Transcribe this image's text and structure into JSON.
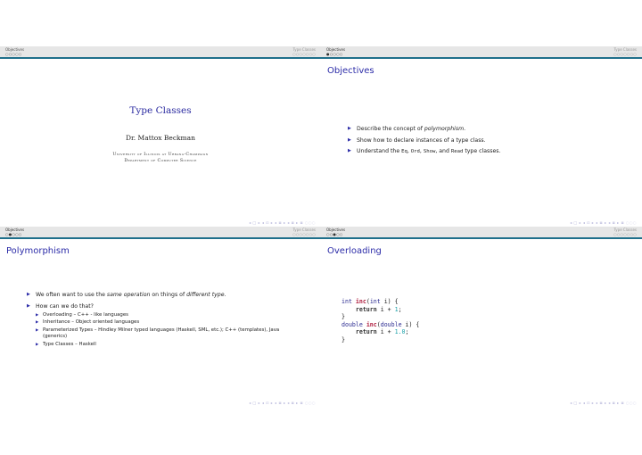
{
  "header": {
    "section_left": "Objectives",
    "section_right": "Type Classes",
    "dots_left_total": 5,
    "dots_right_total": 7
  },
  "slides": [
    {
      "kind": "title",
      "active_section": "none",
      "active_dot": 0,
      "title": "Type Classes",
      "author": "Dr. Mattox Beckman",
      "institution_line1": "University of Illinois at Urbana-Champaign",
      "institution_line2": "Department of Computer Science"
    },
    {
      "kind": "bullets",
      "active_section": "Objectives",
      "active_dot": 1,
      "frametitle": "Objectives",
      "items": [
        {
          "pre": "Describe the concept of ",
          "em": "polymorphism",
          "post": "."
        },
        {
          "text": "Show how to declare instances of a type class."
        },
        {
          "pre": "Understand the ",
          "code1": "Eq",
          "sep1": ", ",
          "code2": "Ord",
          "sep2": ", ",
          "code3": "Show",
          "sep3": ", and ",
          "code4": "Read",
          "post": " type classes."
        }
      ]
    },
    {
      "kind": "bullets",
      "active_section": "Objectives",
      "active_dot": 2,
      "frametitle": "Polymorphism",
      "items": [
        {
          "pre": "We often want to use the ",
          "em1": "same operation",
          "mid": " on things of ",
          "em2": "different type",
          "post": "."
        },
        {
          "text": "How can we do that?",
          "sub": [
            "Overloading – C++ - like languages",
            "Inheritance – Object oriented languages",
            "Parameterized Types – Hindley Milner typed languages (Haskell, SML, etc.); C++ (templates), Java (generics)",
            "Type Classes – Haskell"
          ]
        }
      ]
    },
    {
      "kind": "code",
      "active_section": "Objectives",
      "active_dot": 3,
      "frametitle": "Overloading",
      "code": {
        "l1_type": "int",
        "l1_fn": "inc",
        "l1_open": "(",
        "l1_ptype": "int",
        "l1_rest": " i) {",
        "l2_kw": "return",
        "l2_expr": " i + ",
        "l2_num": "1",
        "l2_end": ";",
        "l3": "}",
        "l4_type": "double",
        "l4_fn": "inc",
        "l4_open": "(",
        "l4_ptype": "double",
        "l4_rest": " i) {",
        "l5_kw": "return",
        "l5_expr": " i + ",
        "l5_num": "1.0",
        "l5_end": ";",
        "l6": "}"
      }
    }
  ],
  "nav_symbols": "◂ □ ▸ ◂ ⊡ ▸ ◂ ≣ ▸ ◂ ≣ ▸   ≣   ◌◌◌",
  "colors": {
    "title_blue": "#2c2ca8",
    "header_grey": "#e6e6e6",
    "header_bar": "#1f6f8b",
    "code_fn": "#b02040",
    "code_num": "#1aa0a8"
  }
}
